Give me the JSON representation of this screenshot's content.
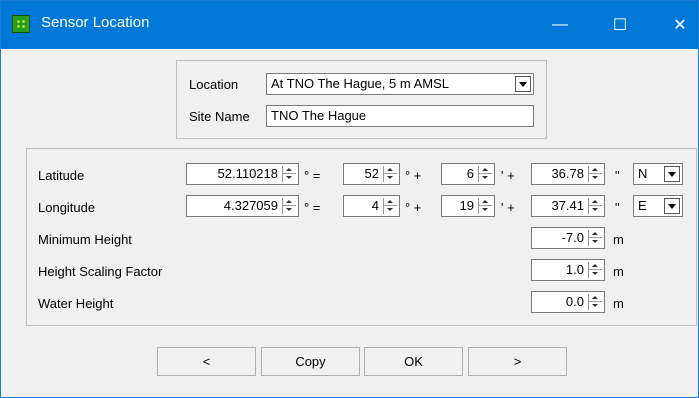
{
  "window": {
    "title": "Sensor Location",
    "minimize_glyph": "—",
    "maximize_glyph": "☐",
    "close_glyph": "✕"
  },
  "location": {
    "label": "Location",
    "selected": "At TNO The Hague, 5 m AMSL",
    "site_label": "Site Name",
    "site_value": "TNO The Hague"
  },
  "latitude": {
    "label": "Latitude",
    "decimal": "52.110218",
    "deg": "52",
    "min": "6",
    "sec": "36.78",
    "hemisphere": "N"
  },
  "longitude": {
    "label": "Longitude",
    "decimal": "4.327059",
    "deg": "4",
    "min": "19",
    "sec": "37.41",
    "hemisphere": "E"
  },
  "symbols": {
    "degree_eq": "° =",
    "degree_plus": "° +",
    "minute_plus": "' +",
    "second": "\""
  },
  "min_height": {
    "label": "Minimum Height",
    "value": "-7.0",
    "unit": "m"
  },
  "scaling": {
    "label": "Height Scaling Factor",
    "value": "1.0",
    "unit": "m"
  },
  "water": {
    "label": "Water Height",
    "value": "0.0",
    "unit": "m"
  },
  "buttons": {
    "prev": "<",
    "copy": "Copy",
    "ok": "OK",
    "next": ">"
  }
}
